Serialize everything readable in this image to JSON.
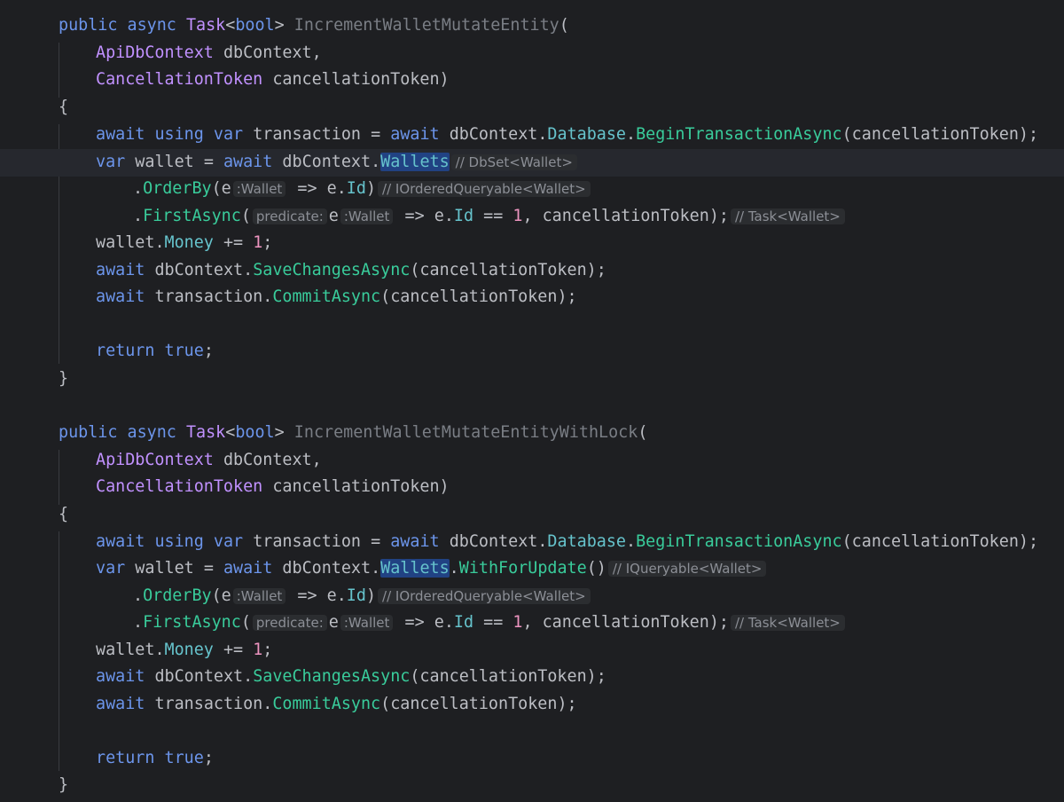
{
  "colors": {
    "background": "#1e1f22",
    "keyword": "#6c95eb",
    "type": "#c191ff",
    "method": "#39cc9b",
    "field": "#66c3cc",
    "number": "#ed94c0",
    "plain": "#bcbec4",
    "hint_text": "#8c8f96"
  },
  "tokens": {
    "public": "public",
    "async": "async",
    "task": "Task",
    "lt": "<",
    "bool": "bool",
    "gt": ">",
    "method1": "IncrementWalletMutateEntity",
    "method2": "IncrementWalletMutateEntityWithLock",
    "open_paren": "(",
    "close_paren": ")",
    "api_db_context": "ApiDbContext",
    "db_context": "dbContext",
    "comma": ",",
    "cancellation_token_type": "CancellationToken",
    "cancellation_token": "cancellationToken",
    "open_brace": "{",
    "close_brace": "}",
    "await": "await",
    "using": "using",
    "var": "var",
    "transaction": "transaction",
    "assign": "=",
    "dot": ".",
    "database": "Database",
    "begin_transaction": "BeginTransactionAsync",
    "semicolon": ";",
    "wallet": "wallet",
    "wallets": "Wallets",
    "with_for_update": "WithForUpdate",
    "order_by": "OrderBy",
    "first_async": "FirstAsync",
    "e": "e",
    "arrow": "=>",
    "id": "Id",
    "equals": "==",
    "one": "1",
    "money": "Money",
    "plus_assign": "+=",
    "save_changes": "SaveChangesAsync",
    "commit": "CommitAsync",
    "return": "return",
    "true": "true"
  },
  "hints": {
    "dbset_wallet": "// DbSet<Wallet>",
    "iqueryable_wallet": "// IQueryable<Wallet>",
    "iordered_queryable_wallet": "// IOrderedQueryable<Wallet>",
    "task_wallet": "// Task<Wallet>",
    "wallet_param": ":Wallet",
    "predicate": "predicate:"
  }
}
